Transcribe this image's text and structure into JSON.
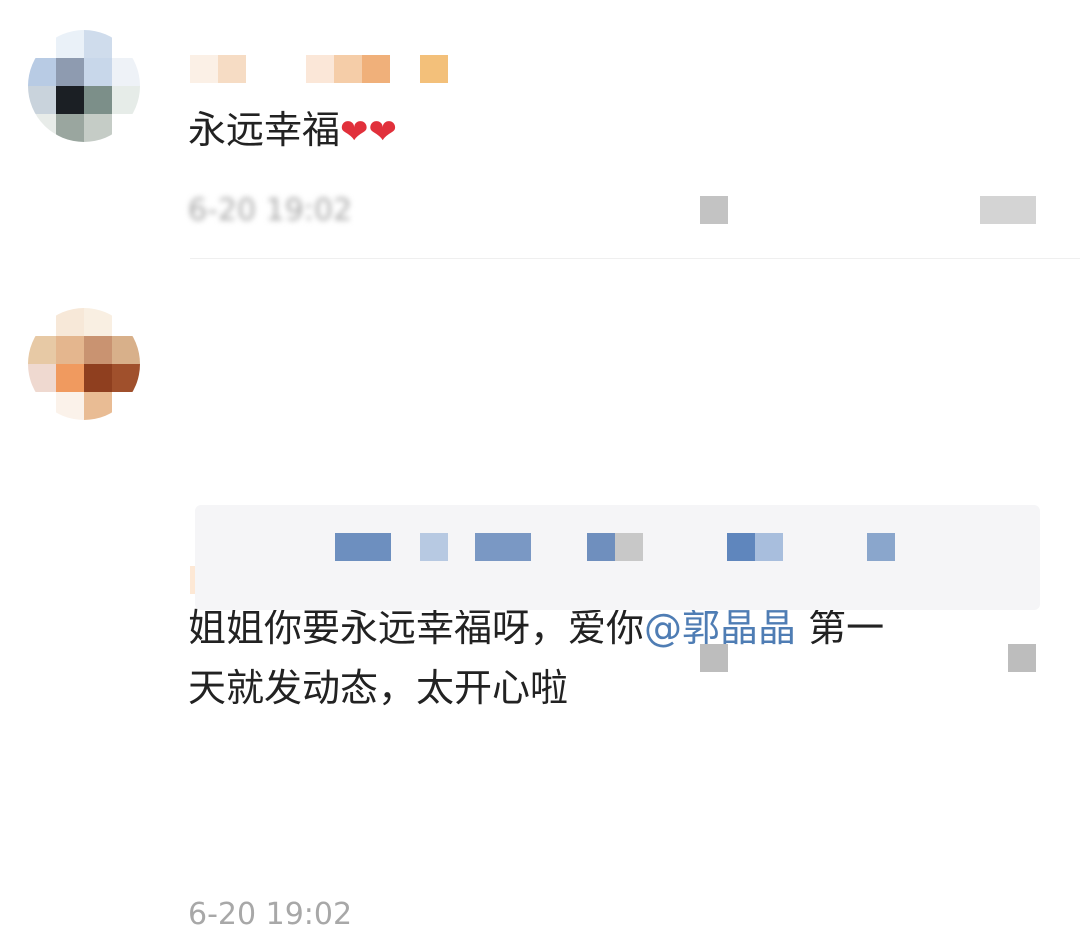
{
  "comments": [
    {
      "text": "永远幸福",
      "hearts": "❤❤",
      "time": "6-20 19:02"
    },
    {
      "text_before": "姐姐你要永远幸福呀，爱你",
      "mention": "@郭晶晶",
      "text_after": " 第一",
      "text_line2": "天就发动态，太开心啦",
      "time": "6-20 19:02"
    }
  ],
  "colors": {
    "mention": "#4f7db4",
    "heart": "#e1303b",
    "timestamp": "#a8a8a8"
  }
}
